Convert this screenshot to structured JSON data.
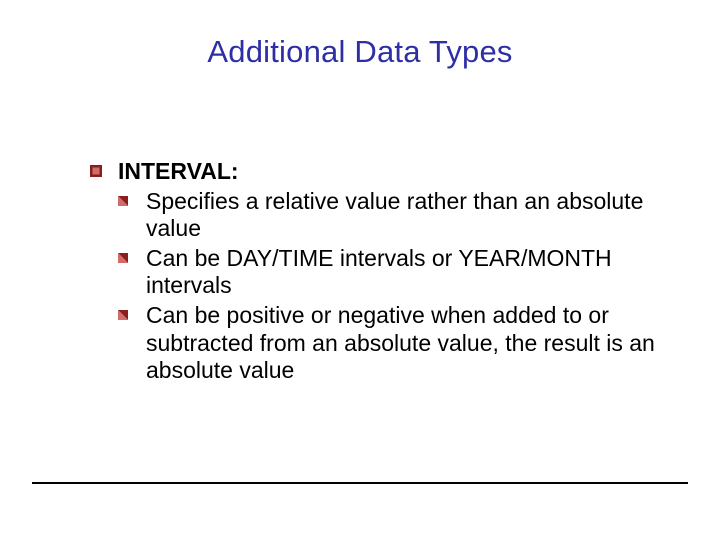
{
  "title": "Additional Data Types",
  "list": {
    "heading": "INTERVAL:",
    "items": [
      "Specifies a relative value rather than an absolute value",
      "Can be DAY/TIME intervals or YEAR/MONTH intervals",
      "Can be positive or negative when added to or subtracted from an absolute value, the result is an absolute value"
    ]
  },
  "colors": {
    "title": "#2e2ea6",
    "bullet_dark": "#8a1e1e",
    "bullet_light": "#d46a6a"
  }
}
